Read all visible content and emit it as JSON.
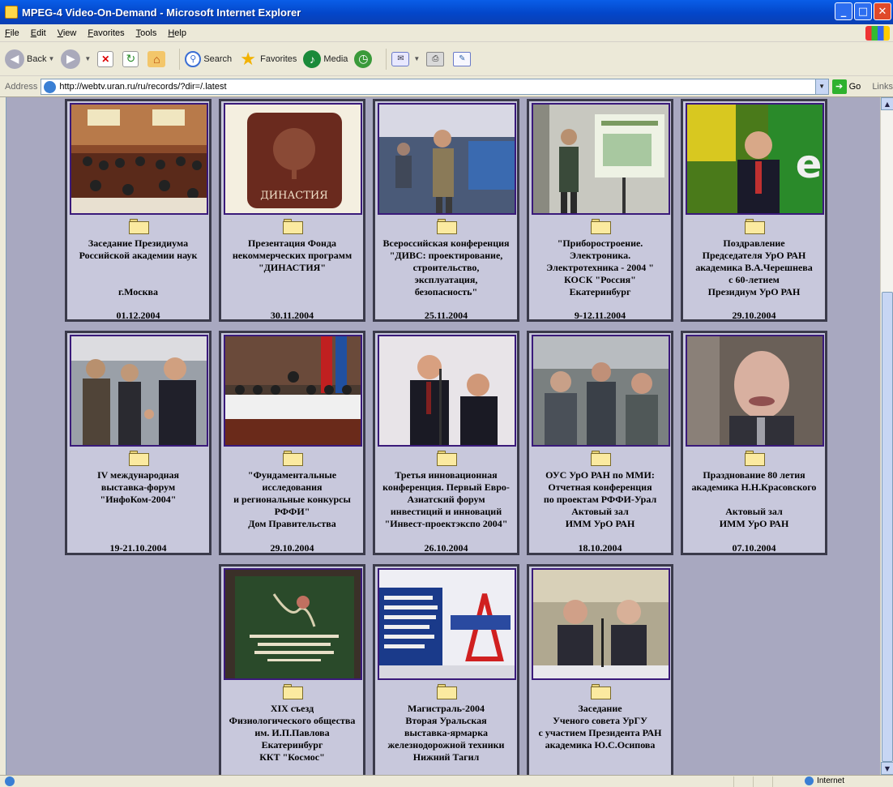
{
  "window": {
    "title": "MPEG-4 Video-On-Demand - Microsoft Internet Explorer",
    "buttons": {
      "minimize": "_",
      "maximize": "□",
      "close": "✕"
    }
  },
  "menu": [
    "File",
    "Edit",
    "View",
    "Favorites",
    "Tools",
    "Help"
  ],
  "toolbar": {
    "back": "Back",
    "search": "Search",
    "favorites": "Favorites",
    "media": "Media"
  },
  "address": {
    "label": "Address",
    "url": "http://webtv.uran.ru/ru/records/?dir=/.latest",
    "go": "Go",
    "links": "Links"
  },
  "status": {
    "zone": "Internet"
  },
  "cards": [
    {
      "caption": "Заседание Президиума\nРоссийской академии наук\n\n\nг.Москва",
      "date": "01.12.2004",
      "thumb": "thumb-conference-hall"
    },
    {
      "caption": "Презентация Фонда\nнекоммерческих программ\n\"ДИНАСТИЯ\"",
      "date": "30.11.2004",
      "thumb": "thumb-dynasty-logo",
      "logo_text": "ДИНАСТИЯ"
    },
    {
      "caption": "Всероссийская конференция\n\"ДИВС: проектирование,\nстроительство,\nэксплуатация,\nбезопасность\"",
      "date": "25.11.2004",
      "thumb": "thumb-speaker-standing"
    },
    {
      "caption": "\"Приборостроение.\nЭлектроника.\nЭлектротехника - 2004 \"\nКОСК \"Россия\"\nЕкатеринбург",
      "date": "9-12.11.2004",
      "thumb": "thumb-projector-screen"
    },
    {
      "caption": "Поздравление\nПредседателя УрО РАН\nакадемика В.А.Черешнева\nс 60-летием\nПрезидиум УрО РАН",
      "date": "29.10.2004",
      "thumb": "thumb-man-at-podium"
    },
    {
      "caption": "IV международная\nвыставка-форум\n\"ИнфоКом-2004\"",
      "date": "19-21.10.2004",
      "thumb": "thumb-handshake"
    },
    {
      "caption": "\"Фундаментальные\nисследования\nи региональные конкурсы\nРФФИ\"\nДом Правительства",
      "date": "29.10.2004",
      "thumb": "thumb-presidium-table"
    },
    {
      "caption": "Третья инновационная\nконференция. Первый Евро-\nАзиатский форум\nинвестиций и инноваций\n\"Инвест-проектэкспо 2004\"",
      "date": "26.10.2004",
      "thumb": "thumb-two-speakers"
    },
    {
      "caption": "ОУС УрО РАН по ММИ:\nОтчетная конференция\nпо проектам РФФИ-Урал\nАктовый зал\nИММ УрО РАН",
      "date": "18.10.2004",
      "thumb": "thumb-audience"
    },
    {
      "caption": "Празднование 80 летия\nакадемика Н.Н.Красовского\n\nАктовый зал\nИММ УрО РАН",
      "date": "07.10.2004",
      "thumb": "thumb-elderly-man"
    },
    {
      "caption": "XIX съезд\nФизиологического общества\nим. И.П.Павлова\nЕкатеринбург\nККТ \"Космос\"",
      "date": "",
      "thumb": "thumb-congress-slide"
    },
    {
      "caption": "Магистраль-2004\nВторая Уральская\nвыставка-ярмарка\nжелезнодорожной техники\nНижний Тагил",
      "date": "",
      "thumb": "thumb-expo-banner"
    },
    {
      "caption": "Заседание\nУченого совета УрГУ\nс участием Президента РАН\nакадемика Ю.С.Осипова",
      "date": "",
      "thumb": "thumb-two-men-table"
    }
  ],
  "colors": {
    "page_bg": "#a8a8c0",
    "card_bg": "#c8c8dc",
    "thumb_border": "#3a1a7a",
    "titlebar": "#0a5ee8"
  }
}
